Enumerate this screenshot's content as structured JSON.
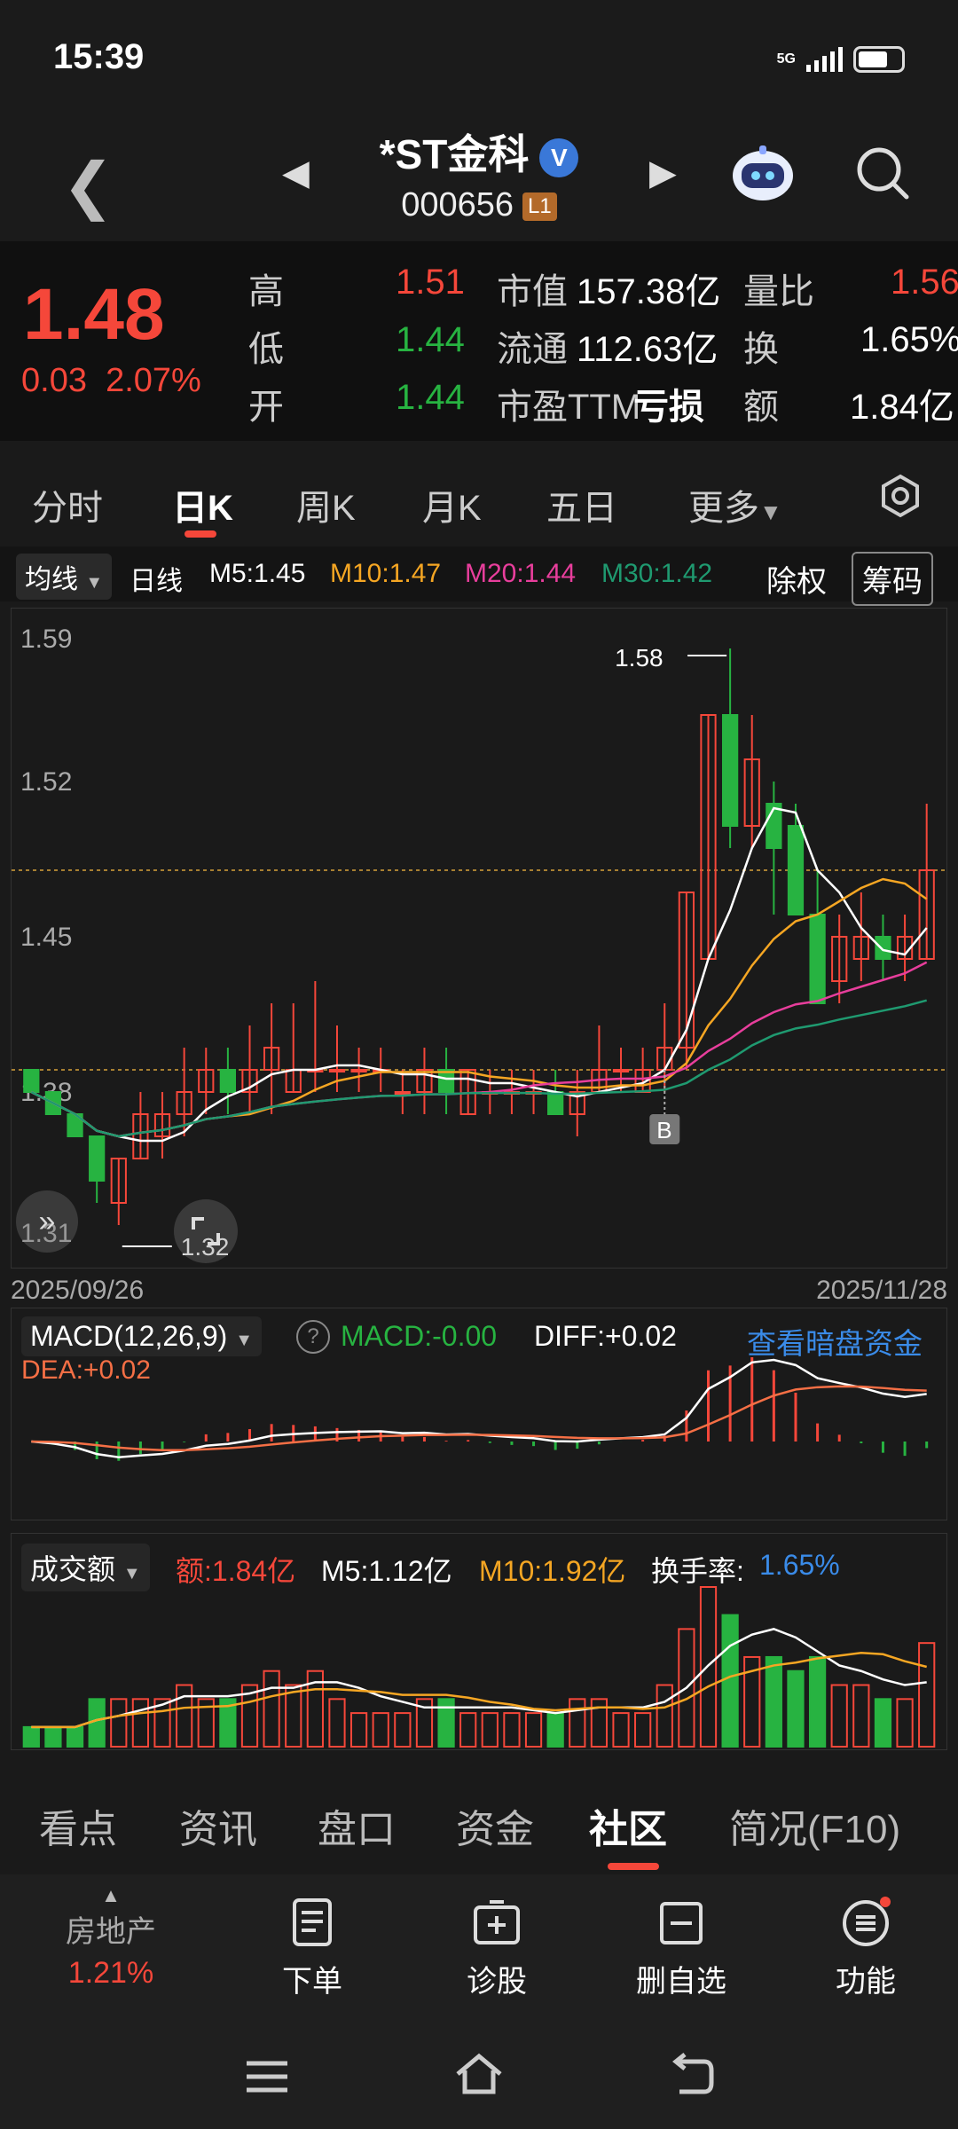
{
  "status": {
    "time": "15:39",
    "network": "5G"
  },
  "header": {
    "stock_name": "*ST金科",
    "code": "000656",
    "level_badge": "L1",
    "verified": "V"
  },
  "quote": {
    "price": "1.48",
    "change": "0.03",
    "change_pct": "2.07%",
    "high_label": "高",
    "high": "1.51",
    "low_label": "低",
    "low": "1.44",
    "open_label": "开",
    "open": "1.44",
    "mktcap_label": "市值",
    "mktcap": "157.38亿",
    "float_label": "流通",
    "float": "112.63亿",
    "pe_label": "市盈TTM",
    "pe": "亏损",
    "vol_ratio_label": "量比",
    "vol_ratio": "1.56",
    "turnover_label": "换",
    "turnover": "1.65%",
    "amount_label": "额",
    "amount": "1.84亿"
  },
  "chart_tabs": [
    "分时",
    "日K",
    "周K",
    "月K",
    "五日",
    "更多"
  ],
  "ma": {
    "selector": "均线",
    "period": "日线",
    "m5": "M5:1.45",
    "m10": "M10:1.47",
    "m20": "M20:1.44",
    "m30": "M30:1.42",
    "exright": "除权",
    "chips": "筹码"
  },
  "kline": {
    "y_labels": [
      "1.59",
      "1.52",
      "1.45",
      "1.38",
      "1.31"
    ],
    "max_label": "1.58",
    "min_label": "1.32",
    "start_date": "2025/09/26",
    "end_date": "2025/11/28",
    "buy_marker": "B"
  },
  "macd": {
    "selector": "MACD(12,26,9)",
    "macd": "MACD:-0.00",
    "diff": "DIFF:+0.02",
    "dea": "DEA:+0.02",
    "link": "查看暗盘资金"
  },
  "volume": {
    "selector": "成交额",
    "amount": "额:1.84亿",
    "m5": "M5:1.12亿",
    "m10": "M10:1.92亿",
    "turnover_label": "换手率:",
    "turnover": "1.65%"
  },
  "bottom_tabs": [
    "看点",
    "资讯",
    "盘口",
    "资金",
    "社区",
    "简况(F10)"
  ],
  "toolbar": {
    "sector": "房地产",
    "sector_pct": "1.21%",
    "order": "下单",
    "diagnose": "诊股",
    "remove_watch": "删自选",
    "functions": "功能"
  },
  "colors": {
    "up": "#f5473a",
    "down": "#27b341",
    "m5": "#ffffff",
    "m10": "#f5a623",
    "m20": "#e83e9c",
    "m30": "#1f9a70"
  },
  "chart_data": {
    "type": "candlestick",
    "x_start": "2025/09/26",
    "x_end": "2025/11/28",
    "ohlc": [
      [
        1.39,
        1.39,
        1.38,
        1.38
      ],
      [
        1.38,
        1.38,
        1.37,
        1.37
      ],
      [
        1.37,
        1.37,
        1.36,
        1.36
      ],
      [
        1.36,
        1.36,
        1.33,
        1.34
      ],
      [
        1.33,
        1.35,
        1.32,
        1.35
      ],
      [
        1.35,
        1.38,
        1.35,
        1.37
      ],
      [
        1.36,
        1.38,
        1.35,
        1.37
      ],
      [
        1.37,
        1.4,
        1.36,
        1.38
      ],
      [
        1.38,
        1.4,
        1.37,
        1.39
      ],
      [
        1.39,
        1.4,
        1.37,
        1.38
      ],
      [
        1.38,
        1.41,
        1.37,
        1.39
      ],
      [
        1.39,
        1.42,
        1.37,
        1.4
      ],
      [
        1.38,
        1.42,
        1.38,
        1.39
      ],
      [
        1.39,
        1.43,
        1.38,
        1.39
      ],
      [
        1.39,
        1.41,
        1.38,
        1.39
      ],
      [
        1.39,
        1.4,
        1.38,
        1.39
      ],
      [
        1.39,
        1.4,
        1.38,
        1.39
      ],
      [
        1.38,
        1.39,
        1.37,
        1.38
      ],
      [
        1.38,
        1.4,
        1.37,
        1.39
      ],
      [
        1.39,
        1.4,
        1.37,
        1.38
      ],
      [
        1.37,
        1.39,
        1.37,
        1.39
      ],
      [
        1.38,
        1.39,
        1.37,
        1.38
      ],
      [
        1.38,
        1.39,
        1.37,
        1.38
      ],
      [
        1.38,
        1.39,
        1.37,
        1.38
      ],
      [
        1.38,
        1.39,
        1.37,
        1.37
      ],
      [
        1.37,
        1.39,
        1.36,
        1.38
      ],
      [
        1.38,
        1.41,
        1.38,
        1.39
      ],
      [
        1.39,
        1.4,
        1.38,
        1.39
      ],
      [
        1.38,
        1.4,
        1.38,
        1.39
      ],
      [
        1.39,
        1.42,
        1.38,
        1.4
      ],
      [
        1.4,
        1.47,
        1.39,
        1.47
      ],
      [
        1.44,
        1.55,
        1.44,
        1.55
      ],
      [
        1.55,
        1.58,
        1.49,
        1.5
      ],
      [
        1.5,
        1.55,
        1.49,
        1.53
      ],
      [
        1.51,
        1.52,
        1.46,
        1.49
      ],
      [
        1.5,
        1.51,
        1.46,
        1.46
      ],
      [
        1.46,
        1.48,
        1.42,
        1.42
      ],
      [
        1.43,
        1.46,
        1.42,
        1.45
      ],
      [
        1.44,
        1.47,
        1.43,
        1.45
      ],
      [
        1.45,
        1.46,
        1.43,
        1.44
      ],
      [
        1.44,
        1.46,
        1.43,
        1.45
      ],
      [
        1.44,
        1.51,
        1.44,
        1.48
      ]
    ],
    "ylim": [
      1.31,
      1.59
    ]
  }
}
